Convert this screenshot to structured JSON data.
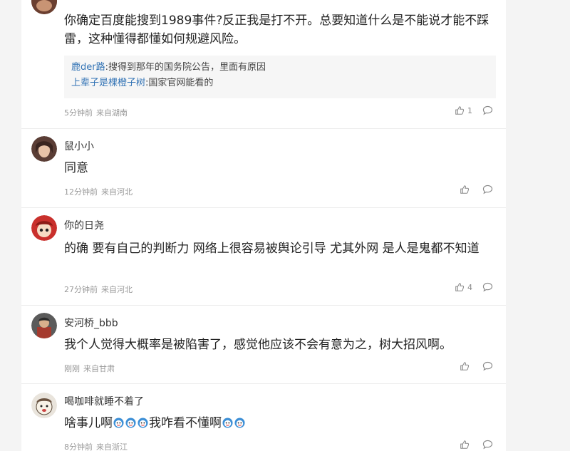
{
  "comments": [
    {
      "username": "",
      "text": "你确定百度能搜到1989事件?反正我是打不开。总要知道什么是不能说才能不踩雷，这种懂得都懂如何规避风险。",
      "replies": [
        {
          "name": "鹿der路",
          "text": ":搜得到那年的国务院公告，里面有原因"
        },
        {
          "name": "上辈子是棵橙子树",
          "text": ":国家官网能看的"
        }
      ],
      "time": "5分钟前",
      "location": "来自湖南",
      "likes": "1"
    },
    {
      "username": "鼠小小",
      "text": "同意",
      "time": "12分钟前",
      "location": "来自河北",
      "likes": ""
    },
    {
      "username": "你的日尧",
      "text": "的确 要有自己的判断力 网络上很容易被舆论引导 尤其外网 是人是鬼都不知道",
      "time": "27分钟前",
      "location": "来自河北",
      "likes": "4"
    },
    {
      "username": "安河桥_bbb",
      "text": "我个人觉得大概率是被陷害了，感觉他应该不会有意为之，树大招风啊。",
      "time": "刚刚",
      "location": "来自甘肃",
      "likes": ""
    },
    {
      "username": "喝咖啡就睡不着了",
      "text_part1": "啥事儿啊",
      "text_part2": "我咋看不懂啊",
      "time": "8分钟前",
      "location": "来自浙江",
      "likes": ""
    }
  ],
  "icons": {
    "like": "thumbs-up-icon",
    "reply": "comment-bubble-icon",
    "emoji": "emoji-face-icon"
  },
  "colors": {
    "reply_name": "#3273b5",
    "meta": "#999999"
  }
}
